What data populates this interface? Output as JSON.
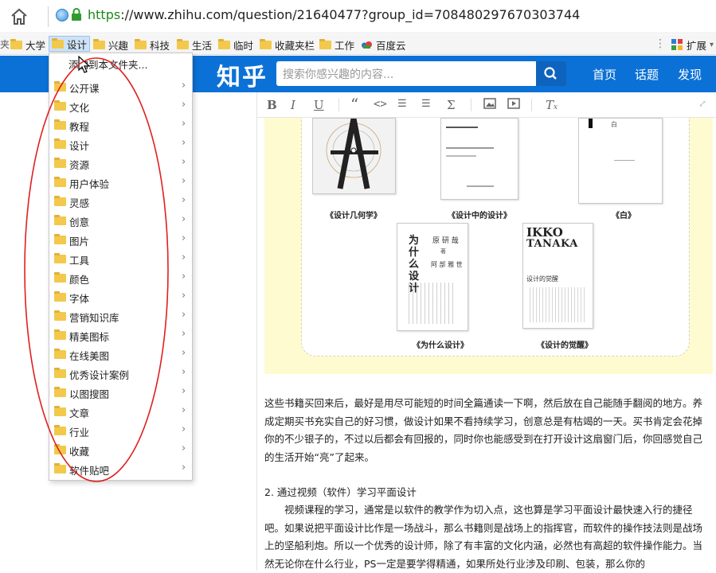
{
  "address_bar": {
    "url_scheme": "https",
    "url_rest": "://www.zhihu.com/question/21640477?group_id=708480297670303744"
  },
  "bookmarks_bar": {
    "edge_text": "夹",
    "items": [
      {
        "label": "大学"
      },
      {
        "label": "设计"
      },
      {
        "label": "兴趣"
      },
      {
        "label": "科技"
      },
      {
        "label": "生活"
      },
      {
        "label": "临时"
      },
      {
        "label": "收藏夹栏"
      },
      {
        "label": "工作"
      },
      {
        "label": "百度云"
      }
    ],
    "extensions_label": "扩展"
  },
  "zhihu_header": {
    "logo": "知乎",
    "search_placeholder": "搜索你感兴趣的内容...",
    "nav": [
      "首页",
      "话题",
      "发现"
    ]
  },
  "bookmark_menu": {
    "add_label": "添加到本文件夹...",
    "folders": [
      "公开课",
      "文化",
      "教程",
      "设计",
      "资源",
      "用户体验",
      "灵感",
      "创意",
      "图片",
      "工具",
      "颜色",
      "字体",
      "营销知识库",
      "精美图标",
      "在线美图",
      "优秀设计案例",
      "以图搜图",
      "文章",
      "行业",
      "收藏",
      "软件贴吧"
    ]
  },
  "books": {
    "captions": [
      "《设计几何学》",
      "《设计中的设计》",
      "《白》",
      "《为什么设计》",
      "《设计的觉醒》"
    ],
    "book4_title": "为什么设计",
    "book4_author": "原 研 哉",
    "book4_with": "著",
    "book4_coauthor": "阿 部 雅 世",
    "book5_title_line1": "IKKO",
    "book5_title_line2": "TANAKA",
    "book5_subtitle": "设计的觉醒",
    "book3_title": "白"
  },
  "article": {
    "para1": "这些书籍买回来后，最好是用尽可能短的时间全篇通读一下啊，然后放在自己能随手翻阅的地方。养成定期买书充实自己的好习惯，做设计如果不看持续学习，创意总是有枯竭的一天。买书肯定会花掉你的不少银子的，不过以后都会有回报的，同时你也能感受到在打开设计这扇窗门后，你回感觉自己的生活开始“亮”了起来。",
    "heading2": "2. 通过视频（软件）学习平面设计",
    "para2": "视频课程的学习，通常是以软件的教学作为切入点，这也算是学习平面设计最快速入行的捷径吧。如果说把平面设计比作是一场战斗，那么书籍则是战场上的指挥官，而软件的操作技法则是战场上的坚船利炮。所以一个优秀的设计师，除了有丰富的文化内涵，必然也有高超的软件操作能力。当然无论你在什么行业，PS一定是要学得精通，如果所处行业涉及印刷、包装，那么你的"
  },
  "colors": {
    "zhihu_blue": "#0b71d6",
    "folder_yellow": "#f2c94c",
    "highlight_red": "#e02020",
    "image_bg": "#fffbd0"
  }
}
